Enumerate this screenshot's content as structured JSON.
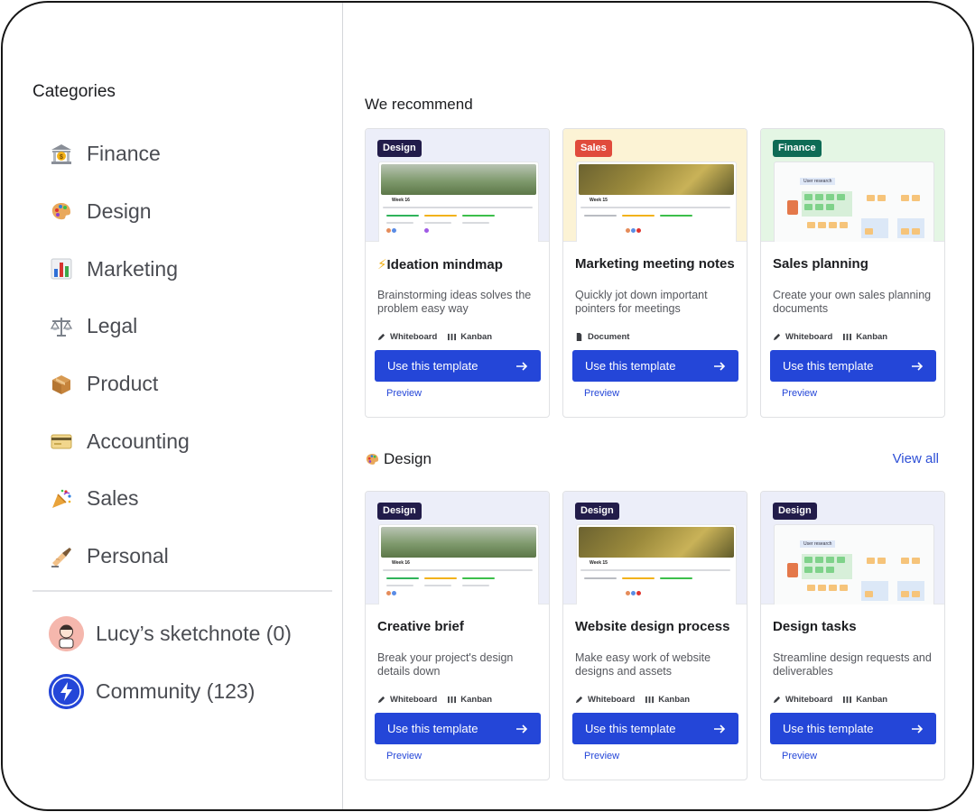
{
  "sidebar": {
    "title": "Categories",
    "categories": [
      {
        "label": "Finance",
        "icon": "bank-icon"
      },
      {
        "label": "Design",
        "icon": "palette-icon"
      },
      {
        "label": "Marketing",
        "icon": "bar-chart-icon"
      },
      {
        "label": "Legal",
        "icon": "scales-icon"
      },
      {
        "label": "Product",
        "icon": "package-icon"
      },
      {
        "label": "Accounting",
        "icon": "credit-card-icon"
      },
      {
        "label": "Sales",
        "icon": "party-popper-icon"
      },
      {
        "label": "Personal",
        "icon": "writing-hand-icon"
      }
    ],
    "spaces": [
      {
        "label": "Lucy’s sketchnote (0)",
        "icon": "lucy-avatar"
      },
      {
        "label": "Community (123)",
        "icon": "community-bolt-icon"
      }
    ]
  },
  "recommend": {
    "title": "We recommend",
    "cards": [
      {
        "badge": "Design",
        "title": "Ideation mindmap",
        "title_prefix": "⚡",
        "desc": "Brainstorming ideas solves the problem easy way",
        "tags": [
          "Whiteboard",
          "Kanban"
        ],
        "cta": "Use this template",
        "preview": "Preview"
      },
      {
        "badge": "Sales",
        "title": "Marketing meeting notes",
        "title_prefix": "",
        "desc": "Quickly jot down important pointers for meetings",
        "tags": [
          "Document"
        ],
        "cta": "Use this template",
        "preview": "Preview"
      },
      {
        "badge": "Finance",
        "title": "Sales planning",
        "title_prefix": "",
        "desc": "Create your own sales planning documents",
        "tags": [
          "Whiteboard",
          "Kanban"
        ],
        "cta": "Use this template",
        "preview": "Preview"
      }
    ]
  },
  "design_section": {
    "title": "Design",
    "view_all": "View all",
    "cards": [
      {
        "badge": "Design",
        "title": "Creative brief",
        "desc": "Break your project's design details down",
        "tags": [
          "Whiteboard",
          "Kanban"
        ],
        "cta": "Use this template",
        "preview": "Preview"
      },
      {
        "badge": "Design",
        "title": "Website design process",
        "desc": "Make easy work of website designs and assets",
        "tags": [
          "Whiteboard",
          "Kanban"
        ],
        "cta": "Use this template",
        "preview": "Preview"
      },
      {
        "badge": "Design",
        "title": "Design tasks",
        "desc": "Streamline design requests and deliverables",
        "tags": [
          "Whiteboard",
          "Kanban"
        ],
        "cta": "Use this template",
        "preview": "Preview"
      }
    ]
  },
  "mock": {
    "week16": "Week 16",
    "week15": "Week 15",
    "user_research": "User research"
  },
  "colors": {
    "primary": "#2446d8",
    "badge_design": "#221c4a",
    "badge_sales": "#e04b3c",
    "badge_finance": "#0e6b55",
    "bg_design": "#eceef9",
    "bg_sales": "#fcf3d5",
    "bg_finance": "#e4f6e4"
  }
}
